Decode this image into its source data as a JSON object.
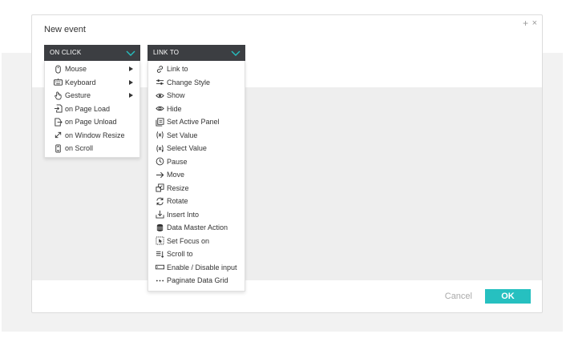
{
  "dialog": {
    "title": "New event",
    "plus_label": "+",
    "close_label": "×",
    "cancel_label": "Cancel",
    "ok_label": "OK"
  },
  "trigger_dropdown": {
    "label": "ON CLICK",
    "items": [
      {
        "label": "Mouse",
        "icon": "mouse-icon",
        "submenu": true
      },
      {
        "label": "Keyboard",
        "icon": "keyboard-icon",
        "submenu": true
      },
      {
        "label": "Gesture",
        "icon": "hand-icon",
        "submenu": true
      },
      {
        "label": "on Page Load",
        "icon": "page-load-icon",
        "submenu": false
      },
      {
        "label": "on Page Unload",
        "icon": "page-unload-icon",
        "submenu": false
      },
      {
        "label": "on Window Resize",
        "icon": "resize-arrows-icon",
        "submenu": false
      },
      {
        "label": "on Scroll",
        "icon": "scroll-icon",
        "submenu": false
      }
    ]
  },
  "action_dropdown": {
    "label": "LINK TO",
    "items": [
      {
        "label": "Link to",
        "icon": "link-icon"
      },
      {
        "label": "Change Style",
        "icon": "sliders-icon"
      },
      {
        "label": "Show",
        "icon": "eye-icon"
      },
      {
        "label": "Hide",
        "icon": "eye-hidden-icon"
      },
      {
        "label": "Set Active Panel",
        "icon": "panel-icon"
      },
      {
        "label": "Set Value",
        "icon": "variable-icon"
      },
      {
        "label": "Select Value",
        "icon": "select-variable-icon"
      },
      {
        "label": "Pause",
        "icon": "clock-icon"
      },
      {
        "label": "Move",
        "icon": "arrow-right-icon"
      },
      {
        "label": "Resize",
        "icon": "resize-icon"
      },
      {
        "label": "Rotate",
        "icon": "rotate-icon"
      },
      {
        "label": "Insert Into",
        "icon": "insert-icon"
      },
      {
        "label": "Data Master Action",
        "icon": "database-icon"
      },
      {
        "label": "Set Focus on",
        "icon": "focus-icon"
      },
      {
        "label": "Scroll to",
        "icon": "scroll-to-icon"
      },
      {
        "label": "Enable / Disable input",
        "icon": "input-icon"
      },
      {
        "label": "Paginate Data Grid",
        "icon": "ellipsis-icon"
      }
    ]
  },
  "colors": {
    "accent": "#26c0c0",
    "header_bg": "#3c3e42",
    "chevron": "#26c0c0"
  }
}
